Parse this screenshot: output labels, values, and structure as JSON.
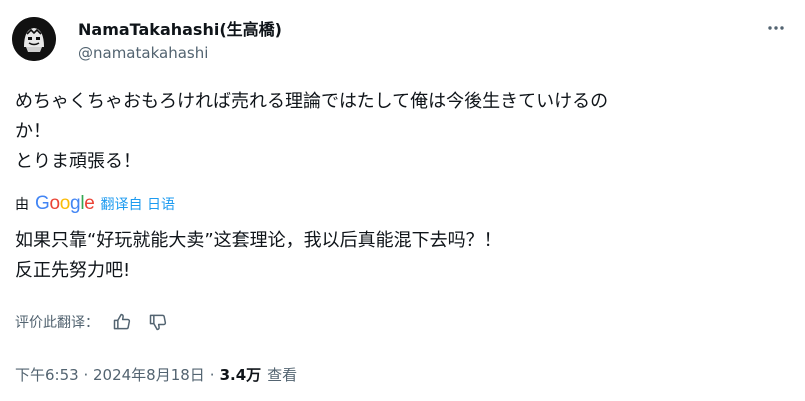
{
  "author": {
    "display_name": "NamaTakahashi(生高橋)",
    "handle": "@namatakahashi",
    "avatar_icon": "avatar-mask-icon"
  },
  "icons": {
    "more": "more-options-icon",
    "like_translation": "thumbs-up-icon",
    "dislike_translation": "thumbs-down-icon"
  },
  "tweet": {
    "text_lines": [
      "めちゃくちゃおもろければ売れる理論ではたして俺は今後生きていけるの",
      "か！",
      "とりま頑張る！"
    ]
  },
  "translation": {
    "by_label": "由",
    "provider": "Google",
    "provider_colors": [
      "#4285F4",
      "#EA4335",
      "#FBBC05",
      "#4285F4",
      "#34A853",
      "#EA4335"
    ],
    "link_text": "翻译自 日语",
    "text_lines": [
      "如果只靠“好玩就能大卖”这套理论，我以后真能混下去吗？！",
      "反正先努力吧!"
    ],
    "rate_label": "评价此翻译："
  },
  "meta": {
    "time": "下午6:53 · 2024年8月18日",
    "separator": "·",
    "views_count": "3.4万",
    "views_label": "查看"
  },
  "colors": {
    "text_primary": "#0f1419",
    "text_secondary": "#536471",
    "link": "#1d9bf0"
  }
}
